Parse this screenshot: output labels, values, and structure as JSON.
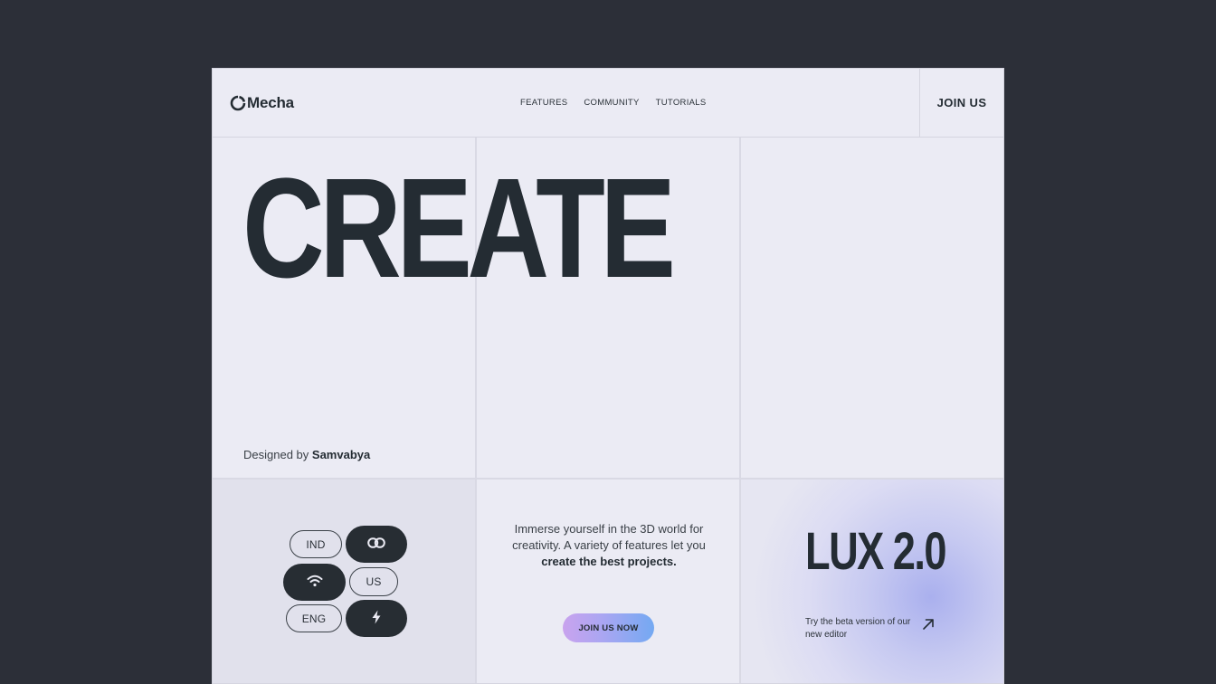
{
  "header": {
    "logo_text": "Mecha",
    "nav": [
      "FEATURES",
      "COMMUNITY",
      "TUTORIALS"
    ],
    "join_label": "JOIN US"
  },
  "hero": {
    "title": "CREATE",
    "credit_prefix": "Designed by",
    "credit_name": "Samvabya"
  },
  "pills": {
    "ind": "IND",
    "us": "US",
    "eng": "ENG",
    "icons": [
      "link-icon",
      "wifi-icon",
      "bolt-icon"
    ]
  },
  "middle": {
    "desc_line1": "Immerse yourself in the 3D world for",
    "desc_line2": "creativity. A variety of features let you",
    "desc_bold": "create the best projects.",
    "cta_label": "JOIN US NOW"
  },
  "lux": {
    "title": "LUX 2.0",
    "beta_text": "Try the beta version of our new editor"
  },
  "colors": {
    "background": "#2c2f38",
    "panel": "#ebebf4",
    "text_dark": "#242c33",
    "cta_gradient_start": "#c9a3ee",
    "cta_gradient_end": "#74a9f2"
  }
}
